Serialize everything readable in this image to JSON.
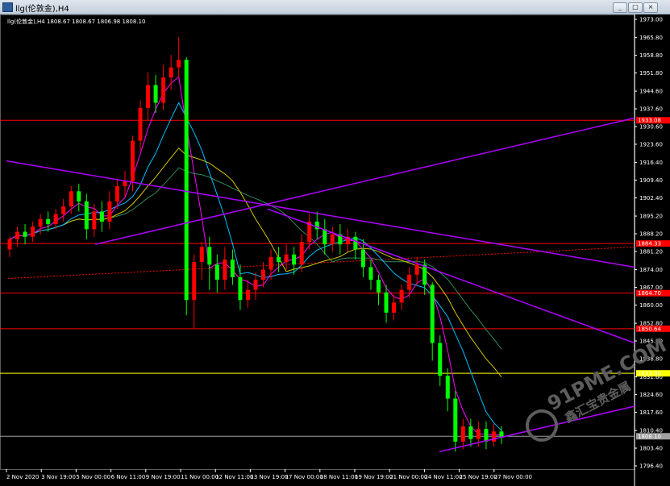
{
  "window": {
    "title": "llg(伦敦金),H4",
    "buttons": [
      "_",
      "□",
      "×"
    ]
  },
  "chart_header": "llg(伦敦金),H4  1808.67 1808.67 1806.98 1808.10",
  "watermark": {
    "line1": "91PME.COM",
    "line2": "鑫汇宝贵金属"
  },
  "colors": {
    "background": "#000000",
    "bull_candle": "#ff0000",
    "bear_candle": "#00ff00",
    "hline_red": "#ff0000",
    "hline_yellow": "#ffff00",
    "hline_gray": "#a0a0a0",
    "trendline": "#b000ff",
    "ma_fast": "#ff00ff",
    "ma_mid": "#00bfff",
    "ma_slow_green": "#2e8b57",
    "ma_slow": "#d4c500"
  },
  "chart_data": {
    "type": "candlestick",
    "ylim": [
      1796.4,
      1973.0
    ],
    "y_ticks": [
      "1973.00",
      "1965.80",
      "1958.80",
      "1951.80",
      "1944.60",
      "1937.60",
      "1930.60",
      "1923.60",
      "1916.40",
      "1909.40",
      "1902.40",
      "1895.20",
      "1888.20",
      "1881.20",
      "1874.00",
      "1867.00",
      "1860.00",
      "1852.80",
      "1845.80",
      "1838.80",
      "1831.60",
      "1824.60",
      "1817.60",
      "1810.40",
      "1803.40",
      "1796.40"
    ],
    "x_labels": [
      "2 Nov 2020",
      "3 Nov 19:00",
      "5 Nov 00:00",
      "6 Nov 11:00",
      "9 Nov 19:00",
      "11 Nov 00:00",
      "12 Nov 11:00",
      "13 Nov 19:00",
      "17 Nov 00:00",
      "18 Nov 11:00",
      "19 Nov 19:00",
      "21 Nov 00:00",
      "24 Nov 11:00",
      "25 Nov 19:00",
      "27 Nov 00:00"
    ],
    "level_labels": [
      "1933.08",
      "1884.33",
      "1864.70",
      "1850.64",
      "1833.00",
      "1808.10"
    ],
    "levels": [
      {
        "value": 1933.08,
        "kind": "red"
      },
      {
        "value": 1884.33,
        "kind": "red"
      },
      {
        "value": 1864.7,
        "kind": "red"
      },
      {
        "value": 1850.64,
        "kind": "red"
      },
      {
        "value": 1833.0,
        "kind": "yellow"
      },
      {
        "value": 1808.1,
        "kind": "gray"
      }
    ],
    "candles": [
      [
        1882,
        1886,
        1879,
        1887
      ],
      [
        1886,
        1889,
        1883,
        1891
      ],
      [
        1889,
        1887,
        1884,
        1892
      ],
      [
        1887,
        1891,
        1885,
        1893
      ],
      [
        1891,
        1894,
        1888,
        1896
      ],
      [
        1894,
        1892,
        1889,
        1897
      ],
      [
        1892,
        1896,
        1890,
        1898
      ],
      [
        1896,
        1899,
        1893,
        1902
      ],
      [
        1899,
        1905,
        1896,
        1907
      ],
      [
        1905,
        1901,
        1897,
        1908
      ],
      [
        1901,
        1890,
        1886,
        1904
      ],
      [
        1890,
        1897,
        1887,
        1900
      ],
      [
        1897,
        1893,
        1889,
        1901
      ],
      [
        1893,
        1901,
        1890,
        1905
      ],
      [
        1901,
        1907,
        1898,
        1910
      ],
      [
        1907,
        1909,
        1903,
        1913
      ],
      [
        1909,
        1925,
        1905,
        1927
      ],
      [
        1925,
        1938,
        1921,
        1941
      ],
      [
        1938,
        1947,
        1933,
        1952
      ],
      [
        1947,
        1940,
        1936,
        1951
      ],
      [
        1940,
        1950,
        1937,
        1955
      ],
      [
        1950,
        1954,
        1945,
        1959
      ],
      [
        1954,
        1957,
        1950,
        1966
      ],
      [
        1957,
        1862,
        1856,
        1958
      ],
      [
        1862,
        1877,
        1851,
        1880
      ],
      [
        1877,
        1883,
        1870,
        1885
      ],
      [
        1883,
        1876,
        1866,
        1887
      ],
      [
        1876,
        1870,
        1865,
        1880
      ],
      [
        1870,
        1878,
        1866,
        1883
      ],
      [
        1878,
        1871,
        1868,
        1882
      ],
      [
        1871,
        1862,
        1858,
        1876
      ],
      [
        1862,
        1866,
        1859,
        1870
      ],
      [
        1866,
        1870,
        1862,
        1873
      ],
      [
        1870,
        1874,
        1867,
        1877
      ],
      [
        1874,
        1879,
        1870,
        1882
      ],
      [
        1879,
        1877,
        1873,
        1883
      ],
      [
        1877,
        1880,
        1874,
        1884
      ],
      [
        1880,
        1876,
        1872,
        1883
      ],
      [
        1876,
        1885,
        1873,
        1888
      ],
      [
        1885,
        1893,
        1882,
        1896
      ],
      [
        1893,
        1890,
        1886,
        1897
      ],
      [
        1890,
        1884,
        1880,
        1894
      ],
      [
        1884,
        1888,
        1881,
        1891
      ],
      [
        1888,
        1884,
        1880,
        1892
      ],
      [
        1884,
        1887,
        1881,
        1890
      ],
      [
        1887,
        1882,
        1878,
        1889
      ],
      [
        1882,
        1875,
        1871,
        1886
      ],
      [
        1875,
        1870,
        1866,
        1878
      ],
      [
        1870,
        1865,
        1860,
        1872
      ],
      [
        1865,
        1857,
        1853,
        1868
      ],
      [
        1857,
        1861,
        1854,
        1864
      ],
      [
        1861,
        1866,
        1858,
        1868
      ],
      [
        1866,
        1872,
        1863,
        1875
      ],
      [
        1872,
        1876,
        1868,
        1879
      ],
      [
        1876,
        1868,
        1864,
        1878
      ],
      [
        1868,
        1845,
        1838,
        1869
      ],
      [
        1845,
        1832,
        1828,
        1848
      ],
      [
        1832,
        1823,
        1818,
        1835
      ],
      [
        1823,
        1806,
        1802,
        1826
      ],
      [
        1806,
        1812,
        1803,
        1815
      ],
      [
        1812,
        1807,
        1804,
        1815
      ],
      [
        1807,
        1811,
        1804,
        1814
      ],
      [
        1811,
        1806,
        1803,
        1814
      ],
      [
        1806,
        1810,
        1804,
        1813
      ],
      [
        1810,
        1808,
        1805,
        1812
      ]
    ]
  }
}
